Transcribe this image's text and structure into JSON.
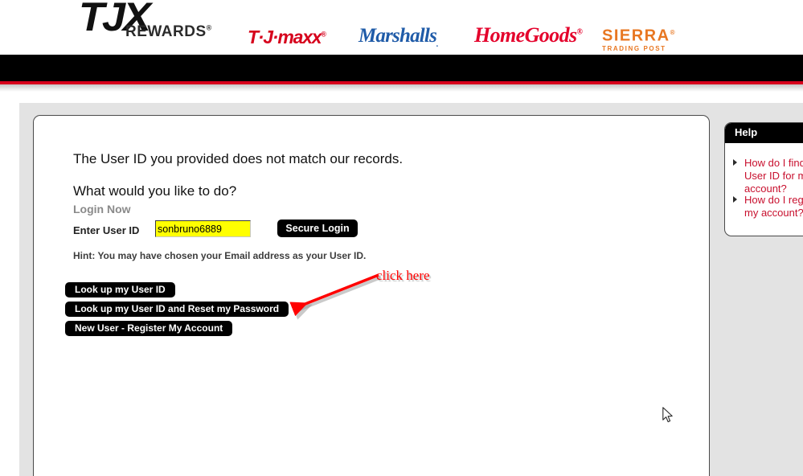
{
  "brand": {
    "tjx_mark": "TJX",
    "tjx_rewards_word": "REWARDS",
    "tjx_rewards_reg": "®",
    "tjmaxx": "T·J·maxx",
    "tjmaxx_reg": "®",
    "marshalls": "Marshalls",
    "marshalls_reg": ".",
    "homegoods": "HomeGoods",
    "homegoods_reg": "®",
    "sierra_main": "SIERRA",
    "sierra_reg": "®",
    "sierra_sub": "TRADING POST",
    "colors": {
      "tjmaxx_red": "#D6001C",
      "marshalls_blue": "#1F5BA8",
      "homegoods_red": "#E4002B",
      "sierra_orange": "#E87722",
      "nav_black": "#000000",
      "rule_red": "#D6001C"
    }
  },
  "main": {
    "error_message": "The User ID you provided does not match our records.",
    "prompt_heading": "What would you like to do?",
    "login_now_label": "Login Now",
    "userid_label": "Enter User ID",
    "userid_value": "sonbruno6889",
    "userid_placeholder": "",
    "secure_login_label": "Secure Login",
    "hint_text": "Hint: You may have chosen your Email address as your User ID.",
    "buttons": [
      {
        "label": "Look up my User ID"
      },
      {
        "label": "Look up my User ID and Reset my Password"
      },
      {
        "label": "New User - Register My Account"
      }
    ]
  },
  "annotation": {
    "text": "click here",
    "color": "#FF0000"
  },
  "help": {
    "title": "Help",
    "links": [
      "How do I find my User ID for my account?",
      "How do I register my account?"
    ],
    "link_color": "#C8102E"
  }
}
